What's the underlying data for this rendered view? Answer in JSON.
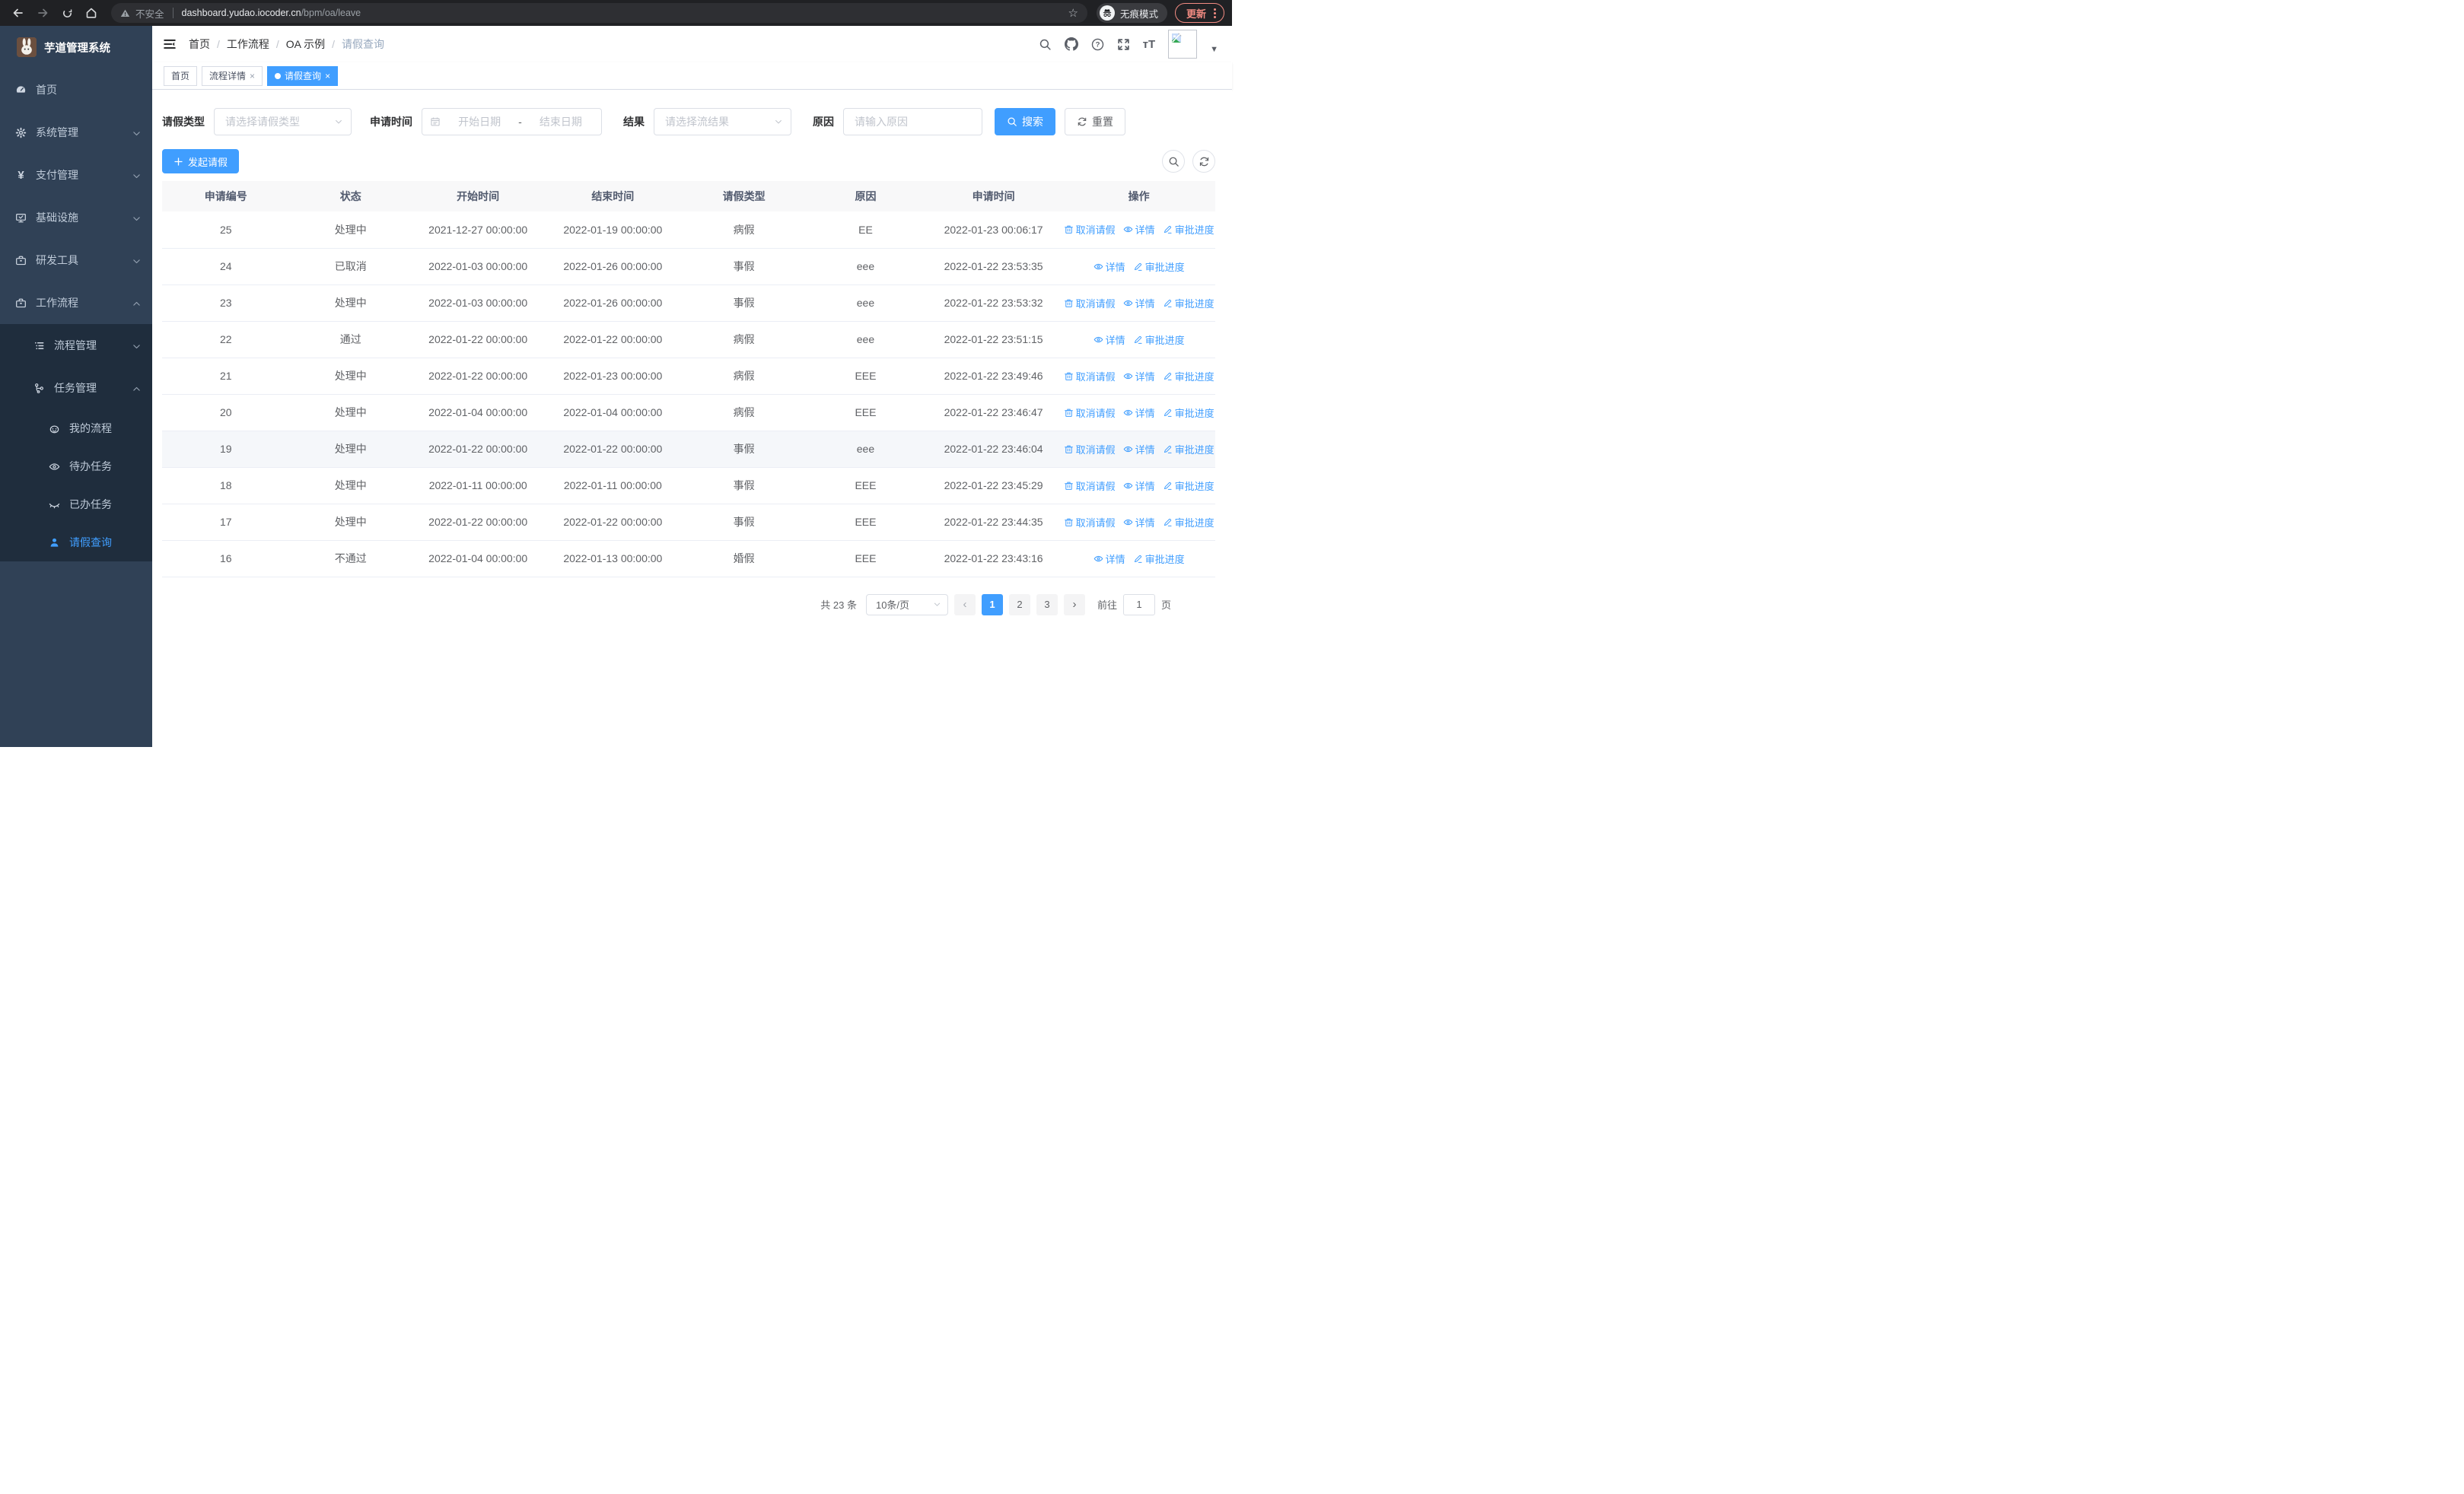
{
  "browser": {
    "security_label": "不安全",
    "url_host": "dashboard.yudao.iocoder.cn",
    "url_path": "/bpm/oa/leave",
    "incognito_label": "无痕模式",
    "update_label": "更新"
  },
  "sidebar": {
    "app_title": "芋道管理系统",
    "items": [
      {
        "label": "首页"
      },
      {
        "label": "系统管理"
      },
      {
        "label": "支付管理"
      },
      {
        "label": "基础设施"
      },
      {
        "label": "研发工具"
      },
      {
        "label": "工作流程"
      },
      {
        "label": "流程管理"
      },
      {
        "label": "任务管理"
      },
      {
        "label": "我的流程"
      },
      {
        "label": "待办任务"
      },
      {
        "label": "已办任务"
      },
      {
        "label": "请假查询"
      }
    ]
  },
  "breadcrumb": {
    "items": [
      "首页",
      "工作流程",
      "OA 示例",
      "请假查询"
    ]
  },
  "tabs": [
    {
      "label": "首页"
    },
    {
      "label": "流程详情"
    },
    {
      "label": "请假查询"
    }
  ],
  "filters": {
    "leave_type_label": "请假类型",
    "leave_type_placeholder": "请选择请假类型",
    "apply_time_label": "申请时间",
    "date_start_placeholder": "开始日期",
    "date_separator": "-",
    "date_end_placeholder": "结束日期",
    "result_label": "结果",
    "result_placeholder": "请选择流结果",
    "reason_label": "原因",
    "reason_placeholder": "请输入原因",
    "search_label": "搜索",
    "reset_label": "重置"
  },
  "toolbar": {
    "create_label": "发起请假"
  },
  "table": {
    "columns": [
      "申请编号",
      "状态",
      "开始时间",
      "结束时间",
      "请假类型",
      "原因",
      "申请时间",
      "操作"
    ],
    "action_labels": {
      "cancel": "取消请假",
      "detail": "详情",
      "progress": "审批进度"
    },
    "rows": [
      {
        "id": "25",
        "status": "处理中",
        "start": "2021-12-27 00:00:00",
        "end": "2022-01-19 00:00:00",
        "type": "病假",
        "reason": "EE",
        "applied": "2022-01-23 00:06:17",
        "can_cancel": true,
        "highlight": false
      },
      {
        "id": "24",
        "status": "已取消",
        "start": "2022-01-03 00:00:00",
        "end": "2022-01-26 00:00:00",
        "type": "事假",
        "reason": "eee",
        "applied": "2022-01-22 23:53:35",
        "can_cancel": false,
        "highlight": false
      },
      {
        "id": "23",
        "status": "处理中",
        "start": "2022-01-03 00:00:00",
        "end": "2022-01-26 00:00:00",
        "type": "事假",
        "reason": "eee",
        "applied": "2022-01-22 23:53:32",
        "can_cancel": true,
        "highlight": false
      },
      {
        "id": "22",
        "status": "通过",
        "start": "2022-01-22 00:00:00",
        "end": "2022-01-22 00:00:00",
        "type": "病假",
        "reason": "eee",
        "applied": "2022-01-22 23:51:15",
        "can_cancel": false,
        "highlight": false
      },
      {
        "id": "21",
        "status": "处理中",
        "start": "2022-01-22 00:00:00",
        "end": "2022-01-23 00:00:00",
        "type": "病假",
        "reason": "EEE",
        "applied": "2022-01-22 23:49:46",
        "can_cancel": true,
        "highlight": false
      },
      {
        "id": "20",
        "status": "处理中",
        "start": "2022-01-04 00:00:00",
        "end": "2022-01-04 00:00:00",
        "type": "病假",
        "reason": "EEE",
        "applied": "2022-01-22 23:46:47",
        "can_cancel": true,
        "highlight": false
      },
      {
        "id": "19",
        "status": "处理中",
        "start": "2022-01-22 00:00:00",
        "end": "2022-01-22 00:00:00",
        "type": "事假",
        "reason": "eee",
        "applied": "2022-01-22 23:46:04",
        "can_cancel": true,
        "highlight": true
      },
      {
        "id": "18",
        "status": "处理中",
        "start": "2022-01-11 00:00:00",
        "end": "2022-01-11 00:00:00",
        "type": "事假",
        "reason": "EEE",
        "applied": "2022-01-22 23:45:29",
        "can_cancel": true,
        "highlight": false
      },
      {
        "id": "17",
        "status": "处理中",
        "start": "2022-01-22 00:00:00",
        "end": "2022-01-22 00:00:00",
        "type": "事假",
        "reason": "EEE",
        "applied": "2022-01-22 23:44:35",
        "can_cancel": true,
        "highlight": false
      },
      {
        "id": "16",
        "status": "不通过",
        "start": "2022-01-04 00:00:00",
        "end": "2022-01-13 00:00:00",
        "type": "婚假",
        "reason": "EEE",
        "applied": "2022-01-22 23:43:16",
        "can_cancel": false,
        "highlight": false
      }
    ]
  },
  "pagination": {
    "total_label": "共 23 条",
    "page_size": "10条/页",
    "prev": "‹",
    "next": "›",
    "pages": [
      "1",
      "2",
      "3"
    ],
    "goto_label": "前往",
    "goto_value": "1",
    "page_unit": "页"
  },
  "colors": {
    "primary": "#409eff",
    "sidebar_bg": "#304156",
    "sidebar_sub_bg": "#1f2d3d",
    "update_accent": "#f28b82"
  }
}
